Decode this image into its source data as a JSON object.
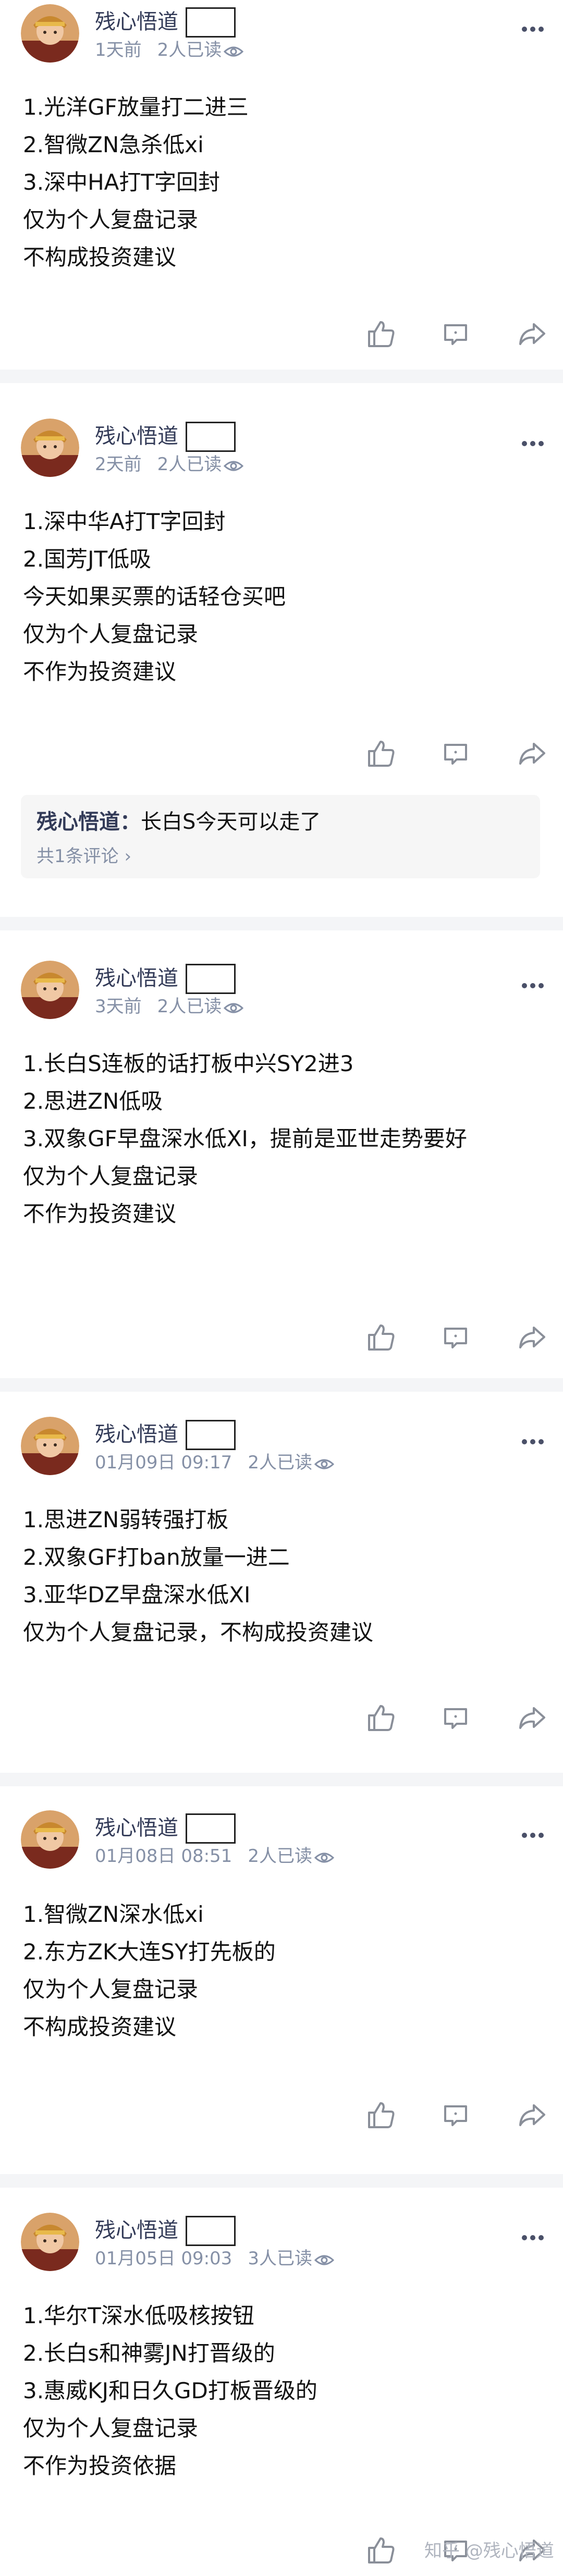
{
  "posts": [
    {
      "author": "残心悟道",
      "time": "1天前",
      "reads": "2人已读",
      "lines": [
        "1.光洋GF放量打二进三",
        "2.智微ZN急杀低xi",
        "3.深中HA打T字回封",
        "仅为个人复盘记录",
        "不构成投资建议"
      ]
    },
    {
      "author": "残心悟道",
      "time": "2天前",
      "reads": "2人已读",
      "lines": [
        "1.深中华A打T字回封",
        "2.国芳JT低吸",
        "今天如果买票的话轻仓买吧",
        "仅为个人复盘记录",
        "不作为投资建议"
      ],
      "comment": {
        "author": "残心悟道：",
        "text": "长白S今天可以走了",
        "count": "共1条评论 ›"
      }
    },
    {
      "author": "残心悟道",
      "time": "3天前",
      "reads": "2人已读",
      "lines": [
        "1.长白S连板的话打板中兴SY2进3",
        "2.思进ZN低吸",
        "3.双象GF早盘深水低XI，提前是亚世走势要好",
        "仅为个人复盘记录",
        "不作为投资建议"
      ]
    },
    {
      "author": "残心悟道",
      "time": "01月09日 09:17",
      "reads": "2人已读",
      "lines": [
        "1.思进ZN弱转强打板",
        "2.双象GF打ban放量一进二",
        "3.亚华DZ早盘深水低XI",
        "仅为个人复盘记录，不构成投资建议"
      ]
    },
    {
      "author": "残心悟道",
      "time": "01月08日 08:51",
      "reads": "2人已读",
      "lines": [
        "1.智微ZN深水低xi",
        "2.东方ZK大连SY打先板的",
        "仅为个人复盘记录",
        "不构成投资建议"
      ]
    },
    {
      "author": "残心悟道",
      "time": "01月05日 09:03",
      "reads": "3人已读",
      "lines": [
        "1.华尔T深水低吸核按钮",
        "2.长白s和神雾JN打晋级的",
        "3.惠威KJ和日久GD打板晋级的",
        "仅为个人复盘记录",
        "不作为投资依据"
      ]
    }
  ],
  "watermark": "知乎 @残心悟道",
  "colors": {
    "author": "#333b58",
    "meta": "#8590a6",
    "separator": "#f4f5f7",
    "icon": "#8a8f99"
  }
}
